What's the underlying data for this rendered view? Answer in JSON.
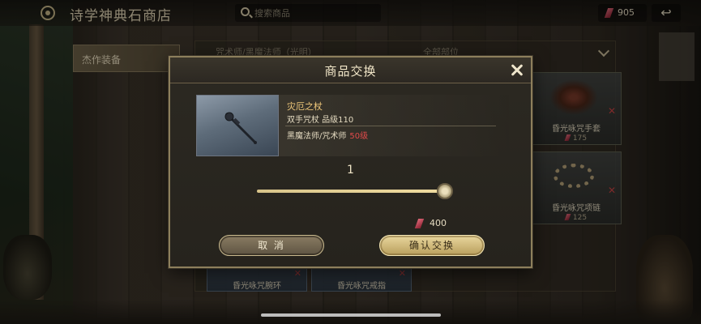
{
  "header": {
    "title": "诗学神典石商店",
    "search_placeholder": "搜索商品",
    "currency_value": "905",
    "back_symbol": "↩"
  },
  "sidebar": {
    "active_tab": "杰作装备"
  },
  "list": {
    "filter_left": "咒术师/黑魔法师（光明）",
    "filter_right": "全部部位",
    "cards": [
      {
        "name": "昏光咏咒手套",
        "price": "175"
      },
      {
        "name": "昏光咏咒项链",
        "price": "125"
      }
    ],
    "bottom_cards": [
      {
        "name": "昏光咏咒腕环"
      },
      {
        "name": "昏光咏咒戒指"
      }
    ]
  },
  "dialog": {
    "title": "商品交换",
    "item": {
      "name": "灾厄之杖",
      "type": "双手咒杖  品级110",
      "class": "黑魔法师/咒术师",
      "level": "50级"
    },
    "quantity": "1",
    "slider_fraction": 1.0,
    "cost": "400",
    "cancel_label": "取 消",
    "confirm_label": "确认交换"
  },
  "colors": {
    "accent_gold": "#e9d79e",
    "level_red": "#e04a4a",
    "item_name": "#f0c87a"
  }
}
